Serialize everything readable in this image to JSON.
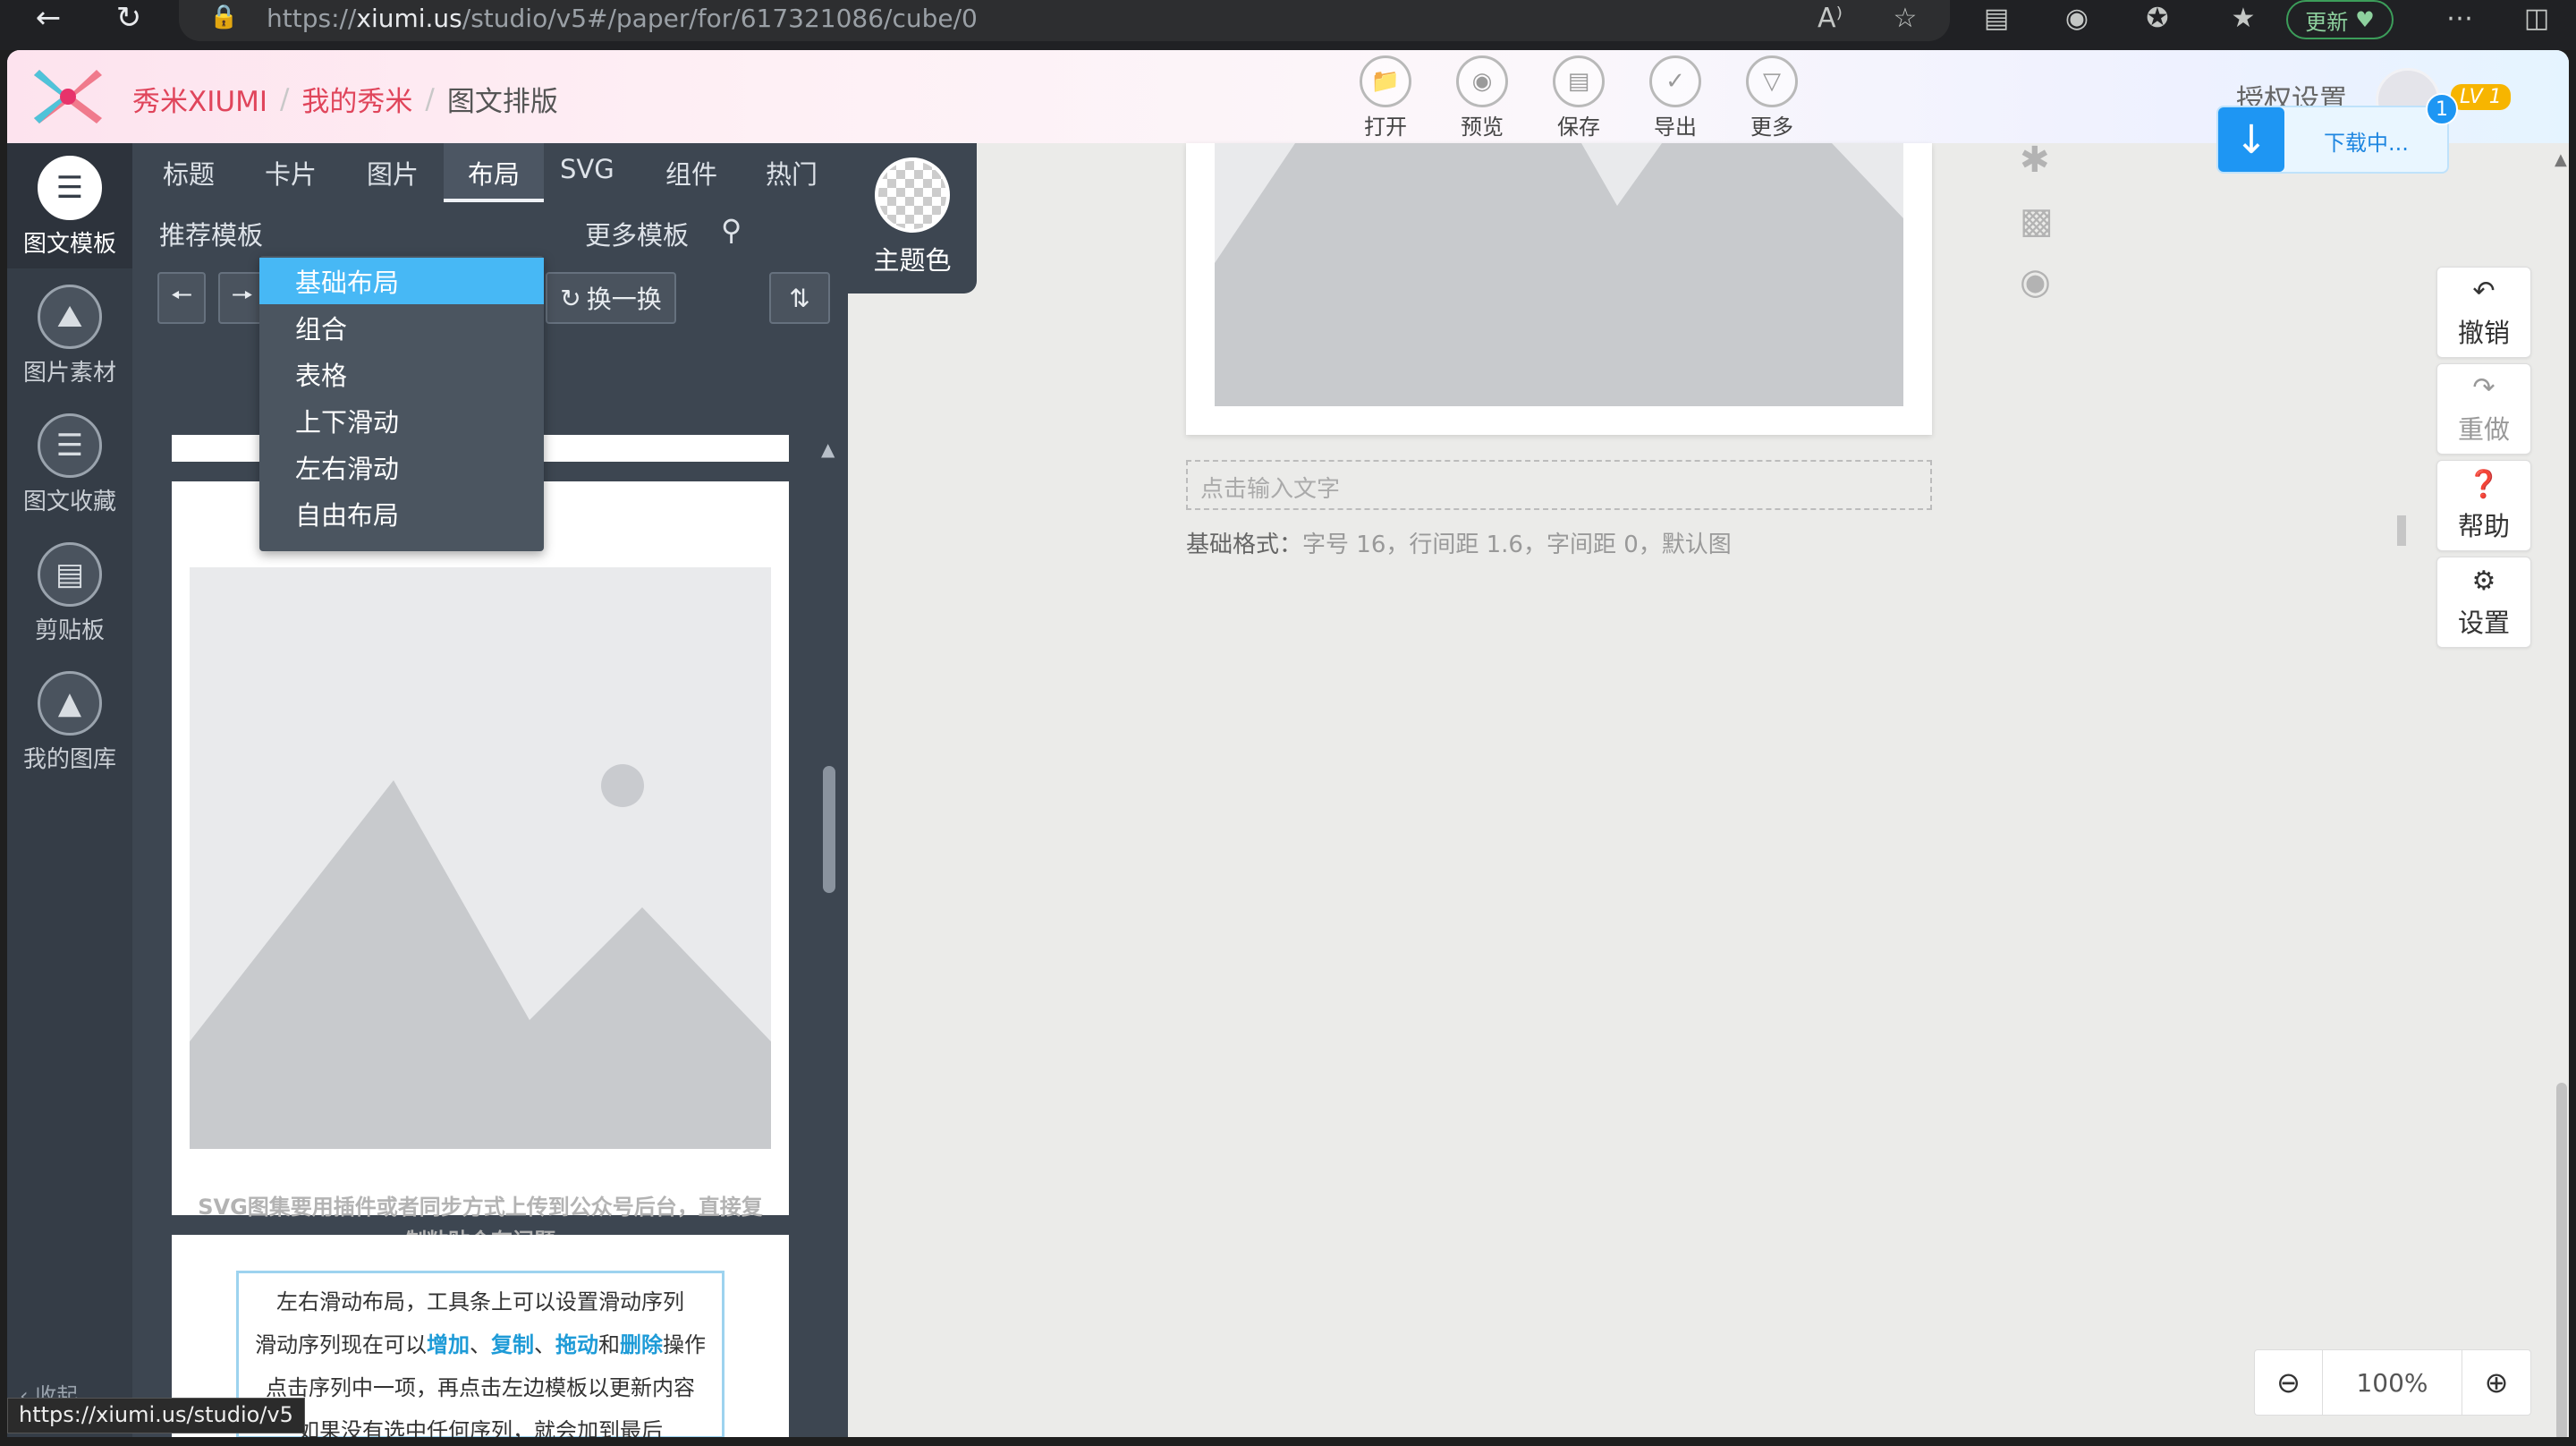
{
  "browser": {
    "url_prefix": "https://",
    "url_domain": "xiumi.us",
    "url_path": "/studio/v5#/paper/for/617321086/cube/0",
    "update_label": "更新",
    "status_url": "https://xiumi.us/studio/v5"
  },
  "header": {
    "brand": "秀米XIUMI",
    "my_xiumi": "我的秀米",
    "current": "图文排版",
    "tools": [
      "打开",
      "预览",
      "保存",
      "导出",
      "更多"
    ],
    "auth_settings": "授权设置",
    "level_badge": "LV 1"
  },
  "download": {
    "label": "下载中...",
    "count": "1"
  },
  "sidebar": {
    "items": [
      "图文模板",
      "图片素材",
      "图文收藏",
      "剪贴板",
      "我的图库"
    ],
    "collapse_label": "收起"
  },
  "panel": {
    "tabs": [
      "标题",
      "卡片",
      "图片",
      "布局",
      "SVG",
      "组件",
      "热门"
    ],
    "active_tab": "布局",
    "subtabs": [
      "推荐模板",
      "更多模板"
    ],
    "shuffle_label": "换一换",
    "theme_label": "主题色"
  },
  "dropdown": {
    "items": [
      "基础布局",
      "组合",
      "表格",
      "上下滑动",
      "左右滑动",
      "自由布局"
    ],
    "active": "基础布局"
  },
  "templates": {
    "svg_caption_line1": "SVG图集要用插件或者同步方式上传到公众号后台，直接复",
    "svg_caption_line2": "制粘贴会有问题",
    "info_line1": "左右滑动布局，工具条上可以设置滑动序列",
    "info_line2_a": "滑动序列现在可以",
    "info_line2_add": "增加",
    "info_line2_sep1": "、",
    "info_line2_copy": "复制",
    "info_line2_sep2": "、",
    "info_line2_drag": "拖动",
    "info_line2_and": "和",
    "info_line2_delete": "删除",
    "info_line2_b": "操作",
    "info_line3": "点击序列中一项，再点击左边模板以更新内容",
    "info_line4": "如果没有选中任何序列，就会加到最后"
  },
  "editor": {
    "text_placeholder": "点击输入文字",
    "format_label": "基础格式：",
    "format_value": "字号 16，行间距 1.6，字间距 0，默认图"
  },
  "actions": [
    "撤销",
    "重做",
    "帮助",
    "设置"
  ],
  "zoom": {
    "value": "100%"
  },
  "colors": {
    "brand_red": "#e0455b",
    "dropdown_active": "#47b8f5",
    "download_blue": "#1e96f3",
    "sidebar_bg": "#353d47",
    "panel_bg": "#3d4651",
    "highlight": "#1e9bd7"
  }
}
